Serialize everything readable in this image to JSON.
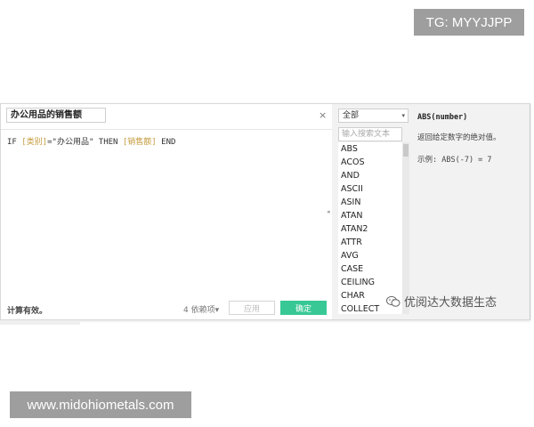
{
  "watermark": {
    "top": "TG: MYYJJPP",
    "bottom": "www.midohiometals.com",
    "wechat_label": "优阅达大数据生态"
  },
  "editor": {
    "calc_name": "办公用品的销售额",
    "close_icon": "×",
    "formula": {
      "if_kw": "IF ",
      "field1": "[类别]",
      "eq_str": "=\"办公用品\" THEN ",
      "field2": "[销售额]",
      "end_kw": " END"
    },
    "status": "计算有效。",
    "dependencies": "4 依赖项",
    "dependencies_arrow": "▾",
    "apply_label": "应用",
    "ok_label": "确定"
  },
  "functions": {
    "category": "全部",
    "category_arrow": "▾",
    "search_placeholder": "输入搜索文本",
    "items": [
      "ABS",
      "ACOS",
      "AND",
      "ASCII",
      "ASIN",
      "ATAN",
      "ATAN2",
      "ATTR",
      "AVG",
      "CASE",
      "CEILING",
      "CHAR",
      "COLLECT"
    ]
  },
  "help": {
    "signature": "ABS(number)",
    "description": "返回给定数字的绝对值。",
    "example": "示例: ABS(-7) = 7"
  },
  "colors": {
    "accent_green": "#38c896",
    "field_color": "#c49a3c"
  }
}
